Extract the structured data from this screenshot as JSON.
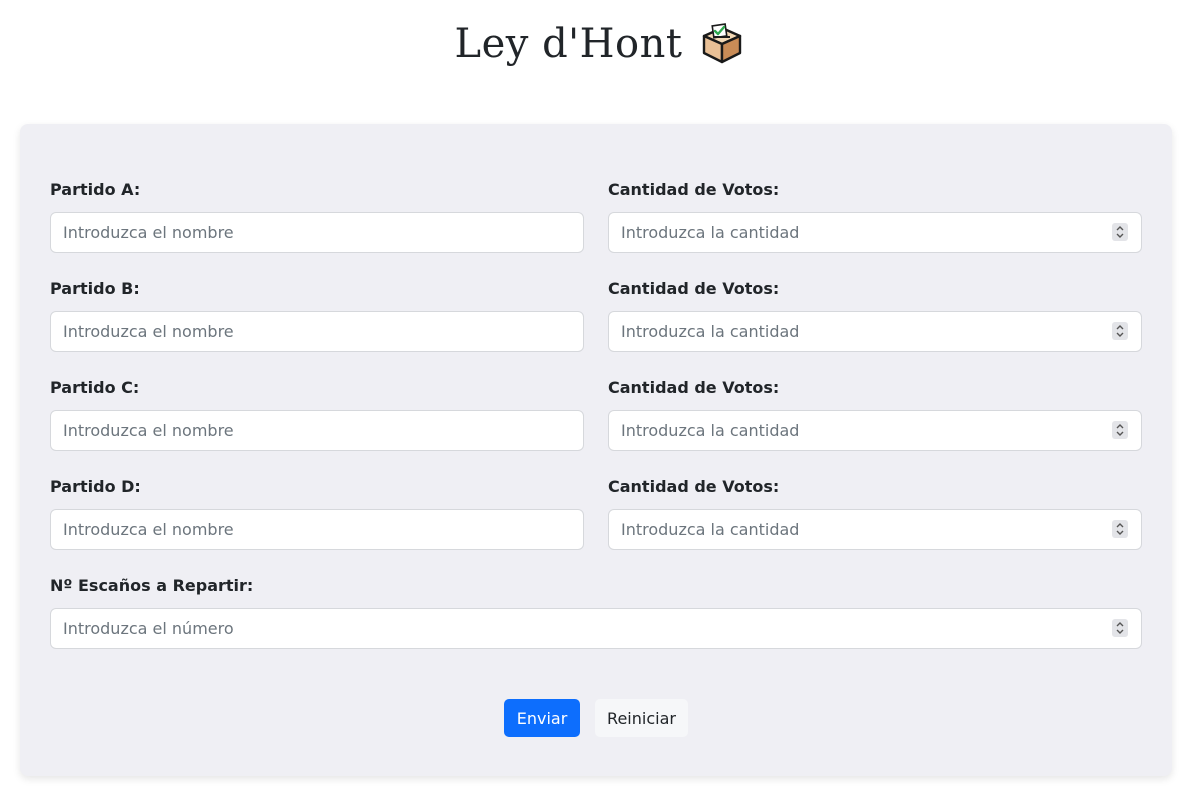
{
  "header": {
    "title": "Ley d'Hont",
    "icon": "ballot-box-icon"
  },
  "form": {
    "parties": [
      {
        "name_label": "Partido A:",
        "name_placeholder": "Introduzca el nombre",
        "votes_label": "Cantidad de Votos:",
        "votes_placeholder": "Introduzca la cantidad"
      },
      {
        "name_label": "Partido B:",
        "name_placeholder": "Introduzca el nombre",
        "votes_label": "Cantidad de Votos:",
        "votes_placeholder": "Introduzca la cantidad"
      },
      {
        "name_label": "Partido C:",
        "name_placeholder": "Introduzca el nombre",
        "votes_label": "Cantidad de Votos:",
        "votes_placeholder": "Introduzca la cantidad"
      },
      {
        "name_label": "Partido D:",
        "name_placeholder": "Introduzca el nombre",
        "votes_label": "Cantidad de Votos:",
        "votes_placeholder": "Introduzca la cantidad"
      }
    ],
    "seats_label": "Nº Escaños a Repartir:",
    "seats_placeholder": "Introduzca el número"
  },
  "actions": {
    "submit_label": "Enviar",
    "reset_label": "Reiniciar"
  },
  "colors": {
    "primary": "#0d6efd",
    "card_background": "#efeff4",
    "secondary_button": "#f6f7f9"
  }
}
